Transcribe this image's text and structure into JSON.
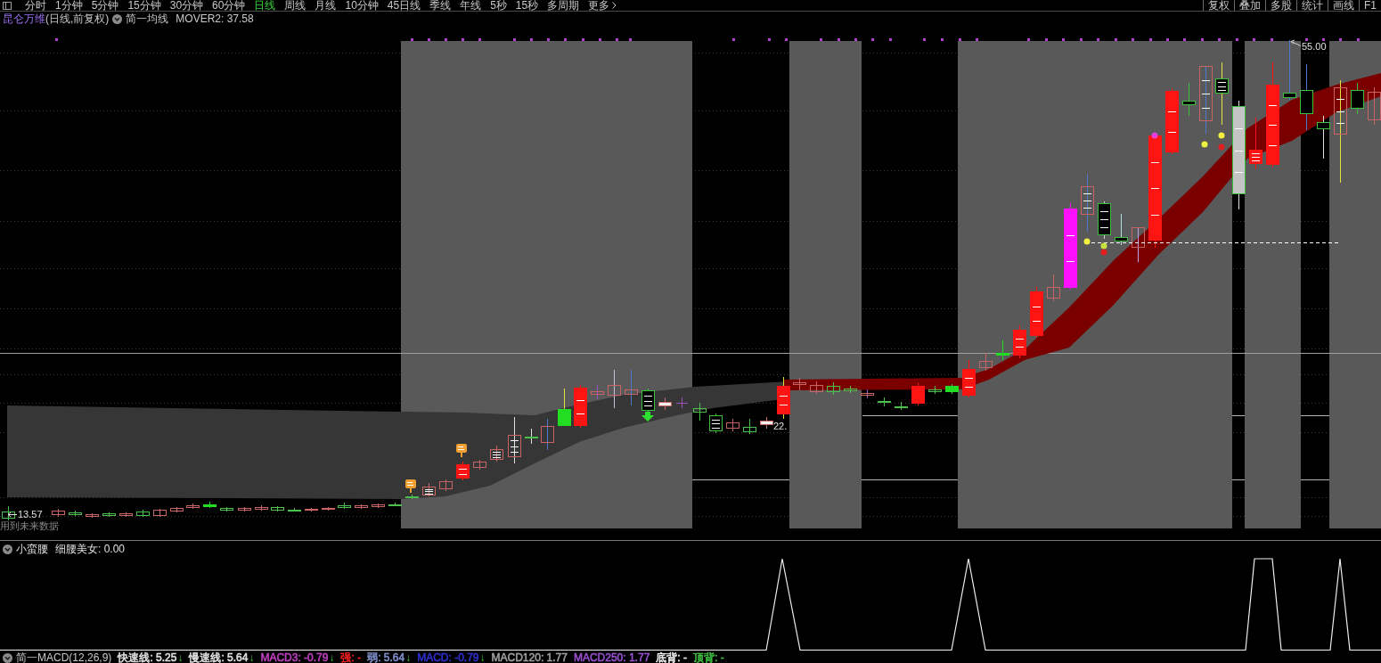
{
  "toolbar": {
    "periods": [
      {
        "label": "分时",
        "selected": false
      },
      {
        "label": "1分钟",
        "selected": false
      },
      {
        "label": "5分钟",
        "selected": false
      },
      {
        "label": "15分钟",
        "selected": false
      },
      {
        "label": "30分钟",
        "selected": false
      },
      {
        "label": "60分钟",
        "selected": false
      },
      {
        "label": "日线",
        "selected": true
      },
      {
        "label": "周线",
        "selected": false
      },
      {
        "label": "月线",
        "selected": false
      },
      {
        "label": "10分钟",
        "selected": false
      },
      {
        "label": "45日线",
        "selected": false
      },
      {
        "label": "季线",
        "selected": false
      },
      {
        "label": "年线",
        "selected": false
      },
      {
        "label": "5秒",
        "selected": false
      },
      {
        "label": "15秒",
        "selected": false
      },
      {
        "label": "多周期",
        "selected": false
      }
    ],
    "more": "更多",
    "actions": [
      "复权",
      "叠加",
      "多股",
      "统计",
      "画线",
      "F1"
    ]
  },
  "chart_header": {
    "stock_name": "昆仑万维",
    "period_mode": "(日线,前复权)",
    "indicator": "简一均线",
    "reading": "MOVER2: 37.58"
  },
  "main_chart": {
    "high_label": "55.00",
    "low_label": "13.57",
    "price_label": "22.",
    "warning": "用到未来数据"
  },
  "sub_chart": {
    "indicator": "小蛮腰",
    "reading": "细腰美女: 0.00"
  },
  "status_bar": {
    "title": "简一MACD(12,26,9)",
    "items": [
      {
        "label": "快速线: 5.25",
        "trend": "↓",
        "color": "#e0e0e0"
      },
      {
        "label": "慢速线: 5.64",
        "trend": "↓",
        "color": "#e0e0e0"
      },
      {
        "label": "MACD3: -0.79",
        "trend": "↓",
        "color": "#c040c0"
      },
      {
        "label": "强: -",
        "color": "#ff2020"
      },
      {
        "label": "弱: 5.64",
        "trend": "↓",
        "color": "#8090cc"
      },
      {
        "label": "MACD: -0.79",
        "trend": "↓",
        "color": "#3030d0"
      },
      {
        "label": "MACD120: 1.77",
        "color": "#a0a0a0"
      },
      {
        "label": "MACD250: 1.77",
        "color": "#9a50d0"
      },
      {
        "label": "底背: -",
        "color": "#f0f0f0"
      },
      {
        "label": "顶背: -",
        "color": "#40c040"
      }
    ]
  }
}
